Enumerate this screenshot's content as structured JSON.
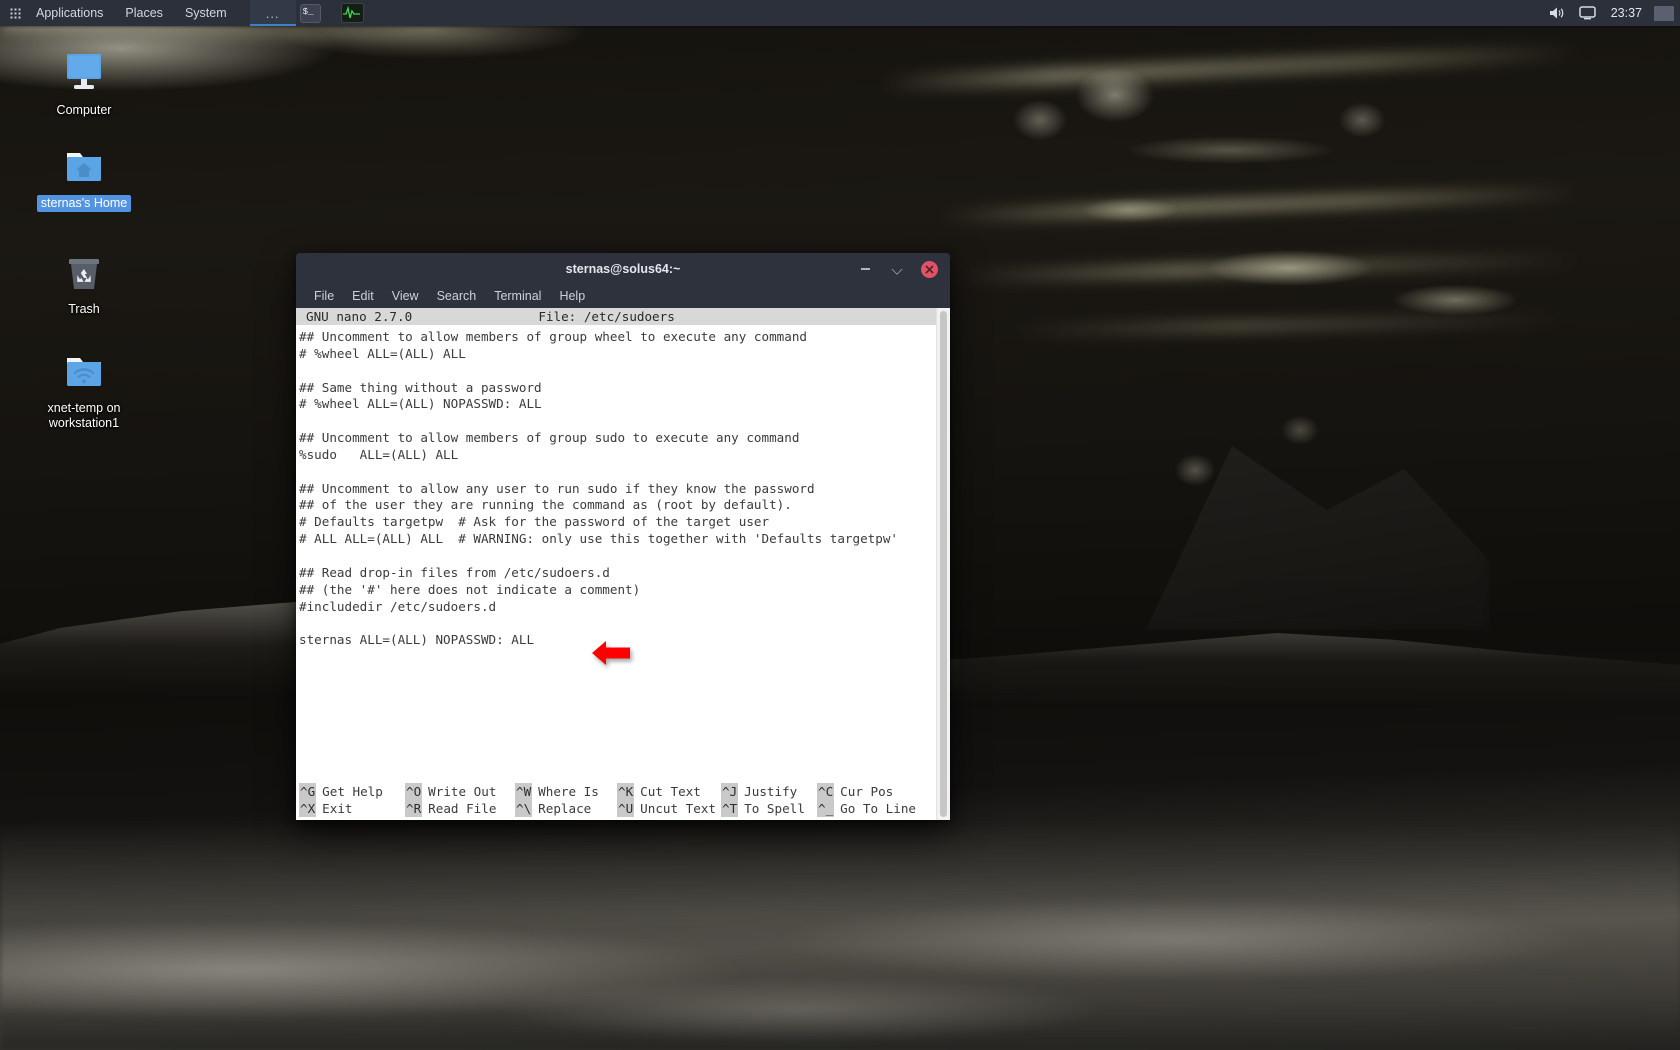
{
  "panel": {
    "apps_grid_icon": "grid-icon",
    "menus": [
      "Applications",
      "Places",
      "System"
    ],
    "window_button_label": "...",
    "tray_icons": [
      "terminal-icon",
      "system-monitor-icon"
    ],
    "status_icons": [
      "volume-icon",
      "display-icon"
    ],
    "clock": "23:37",
    "tile_icon": "workspace-switcher"
  },
  "desktop": {
    "icons": [
      {
        "label": "Computer",
        "icon": "computer-icon",
        "selected": false
      },
      {
        "label": "sternas's Home",
        "icon": "home-folder-icon",
        "selected": true
      },
      {
        "label": "Trash",
        "icon": "trash-icon",
        "selected": false
      },
      {
        "label": "xnet-temp on workstation1",
        "icon": "network-folder-icon",
        "selected": false
      }
    ]
  },
  "terminal": {
    "title": "sternas@solus64:~",
    "controls": {
      "minimize": "−",
      "maximize": "maximize-icon",
      "close": "✕"
    },
    "menubar": [
      "File",
      "Edit",
      "View",
      "Search",
      "Terminal",
      "Help"
    ],
    "nano": {
      "version": "GNU nano 2.7.0",
      "file_label": "File: /etc/sudoers",
      "lines": [
        "## Uncomment to allow members of group wheel to execute any command",
        "# %wheel ALL=(ALL) ALL",
        "",
        "## Same thing without a password",
        "# %wheel ALL=(ALL) NOPASSWD: ALL",
        "",
        "## Uncomment to allow members of group sudo to execute any command",
        "%sudo   ALL=(ALL) ALL",
        "",
        "## Uncomment to allow any user to run sudo if they know the password",
        "## of the user they are running the command as (root by default).",
        "# Defaults targetpw  # Ask for the password of the target user",
        "# ALL ALL=(ALL) ALL  # WARNING: only use this together with 'Defaults targetpw'",
        "",
        "## Read drop-in files from /etc/sudoers.d",
        "## (the '#' here does not indicate a comment)",
        "#includedir /etc/sudoers.d",
        "",
        "sternas ALL=(ALL) NOPASSWD: ALL"
      ],
      "shortcuts_row1": [
        {
          "key": "^G",
          "label": "Get Help"
        },
        {
          "key": "^O",
          "label": "Write Out"
        },
        {
          "key": "^W",
          "label": "Where Is"
        },
        {
          "key": "^K",
          "label": "Cut Text"
        },
        {
          "key": "^J",
          "label": "Justify"
        },
        {
          "key": "^C",
          "label": "Cur Pos"
        }
      ],
      "shortcuts_row2": [
        {
          "key": "^X",
          "label": "Exit"
        },
        {
          "key": "^R",
          "label": "Read File"
        },
        {
          "key": "^\\",
          "label": "Replace"
        },
        {
          "key": "^U",
          "label": "Uncut Text"
        },
        {
          "key": "^T",
          "label": "To Spell"
        },
        {
          "key": "^_",
          "label": "Go To Line"
        }
      ]
    }
  },
  "annotation": {
    "arrow": "red-left-arrow",
    "color": "#FF0000"
  },
  "colors": {
    "panel_bg": "#2b303b",
    "window_bg": "#2e323d",
    "terminal_bg": "#ffffff",
    "terminal_fg": "#3b3b3b",
    "selection_blue": "#5294e2",
    "close_red": "#e05265",
    "nano_bar_bg": "#d8d8d8"
  }
}
